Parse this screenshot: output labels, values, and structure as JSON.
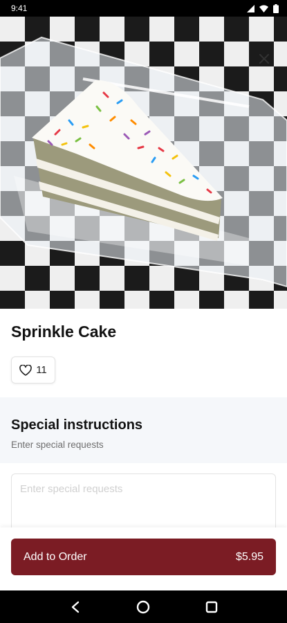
{
  "status_bar": {
    "time": "9:41",
    "icons": [
      "signal-icon",
      "wifi-icon",
      "battery-icon"
    ]
  },
  "item": {
    "name": "Sprinkle Cake",
    "likes": "11",
    "image": "cake-slice-photo"
  },
  "special_instructions": {
    "title": "Special instructions",
    "subtitle": "Enter special requests",
    "placeholder": "Enter special requests",
    "value": ""
  },
  "order_button": {
    "label": "Add to Order",
    "price": "$5.95"
  },
  "colors": {
    "accent": "#7b1c24",
    "section_bg": "#f5f7fa",
    "status_bar": "#000000"
  },
  "nav": {
    "icons": [
      "back-icon",
      "home-icon",
      "recents-icon"
    ]
  }
}
